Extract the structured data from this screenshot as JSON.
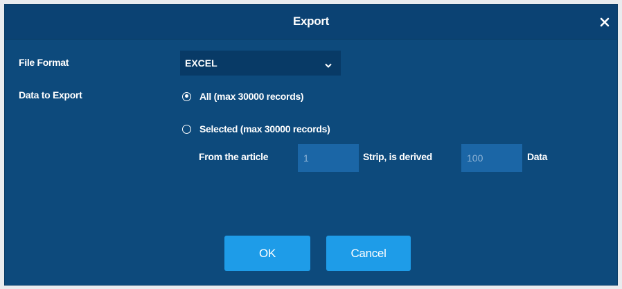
{
  "dialog": {
    "title": "Export",
    "close_icon": "close-icon"
  },
  "file_format": {
    "label": "File Format",
    "selected": "EXCEL",
    "dropdown_icon": "chevron-down-icon"
  },
  "data_to_export": {
    "label": "Data to Export",
    "options": [
      {
        "label": "All (max 30000 records)",
        "checked": true
      },
      {
        "label": "Selected (max 30000 records)",
        "checked": false
      }
    ],
    "range": {
      "from_label": "From the article",
      "from_value": "1",
      "strip_label": "Strip, is derived",
      "count_value": "100",
      "suffix_label": "Data"
    }
  },
  "buttons": {
    "ok_label": "OK",
    "cancel_label": "Cancel"
  },
  "colors": {
    "dialog_bg": "#0d4a7c",
    "titlebar_bg": "#0b4273",
    "select_bg": "#083a66",
    "input_bg": "#1b66a6",
    "button_bg": "#1e9ce8"
  }
}
